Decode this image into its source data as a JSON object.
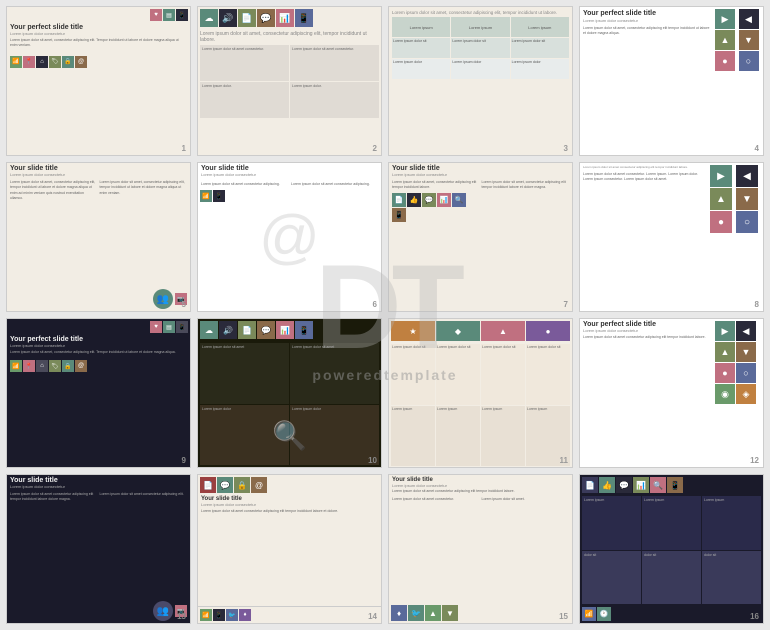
{
  "slides": [
    {
      "id": 1,
      "number": "1",
      "title": "Your perfect slide title",
      "subtitle": "Lorem ipsum dolor consectetur",
      "body": "Lorem ipsum dolor sit amet, consectetur adipiscing elit, tempor incididunt ut labore et dolore magna aliqua ut enim ad minim veniam quis nostrud.",
      "type": "icons-left",
      "bg": "cream",
      "icons": [
        "♥",
        "▤",
        "☰",
        "☊",
        "☌",
        "⌂",
        "☀",
        "✉"
      ]
    },
    {
      "id": 2,
      "number": "2",
      "title": "",
      "type": "icon-grid-top",
      "bg": "light"
    },
    {
      "id": 3,
      "number": "3",
      "title": "",
      "type": "table-grid",
      "bg": "light"
    },
    {
      "id": 4,
      "number": "4",
      "title": "Your perfect slide title",
      "subtitle": "Lorem ipsum dolor consectetur",
      "type": "icons-right",
      "bg": "white"
    },
    {
      "id": 5,
      "number": "5",
      "title": "Your slide title",
      "subtitle": "Lorem ipsum dolor consectetur",
      "body": "Lorem ipsum dolor sit amet, consectetur adipiscing elit...",
      "type": "two-col-text",
      "bg": "cream"
    },
    {
      "id": 6,
      "number": "6",
      "title": "Your slide title",
      "subtitle": "Lorem ipsum dolor consectetur",
      "type": "big-icon",
      "bg": "white"
    },
    {
      "id": 7,
      "number": "7",
      "title": "Your slide title",
      "subtitle": "Lorem ipsum dolor consectetur",
      "type": "two-col-icons",
      "bg": "light"
    },
    {
      "id": 8,
      "number": "8",
      "title": "",
      "type": "icon-list-right",
      "bg": "white"
    },
    {
      "id": 9,
      "number": "9",
      "title": "Your perfect slide title",
      "subtitle": "Lorem ipsum dolor consectetur",
      "type": "dark-icons",
      "bg": "dark"
    },
    {
      "id": 10,
      "number": "10",
      "title": "",
      "type": "dark-grid",
      "bg": "dark"
    },
    {
      "id": 11,
      "number": "11",
      "title": "",
      "type": "colored-grid",
      "bg": "light"
    },
    {
      "id": 12,
      "number": "12",
      "title": "Your perfect slide title",
      "subtitle": "Lorem ipsum dolor consectetur",
      "type": "icon-rows",
      "bg": "white"
    },
    {
      "id": 13,
      "number": "13",
      "title": "Your slide title",
      "subtitle": "Lorem ipsum dolor consectetur",
      "type": "two-col-dark",
      "bg": "dark"
    },
    {
      "id": 14,
      "number": "14",
      "title": "Your slide title",
      "subtitle": "Lorem ipsum dolor consectetur",
      "type": "colored-icons-bottom",
      "bg": "cream"
    },
    {
      "id": 15,
      "number": "15",
      "title": "Your slide title",
      "subtitle": "Lorem ipsum dolor consectetur",
      "type": "two-col-colored",
      "bg": "cream"
    },
    {
      "id": 16,
      "number": "16",
      "title": "",
      "type": "dark-icon-grid",
      "bg": "dark"
    }
  ],
  "watermark": {
    "letters": "DT",
    "text": "poweredtemplate"
  },
  "colors": {
    "teal": "#5a8a7a",
    "dark": "#2a2a3a",
    "olive": "#7a8a5a",
    "brown": "#8a6a4a",
    "blue": "#5a6a9a",
    "pink": "#c07080",
    "green": "#6a9a6a",
    "orange": "#c08040",
    "yellow": "#c0a040",
    "red": "#9a4040",
    "purple": "#7a5a9a",
    "gray": "#9a9aaa",
    "cream": "#f2ede4",
    "light": "#e8e4dc"
  }
}
